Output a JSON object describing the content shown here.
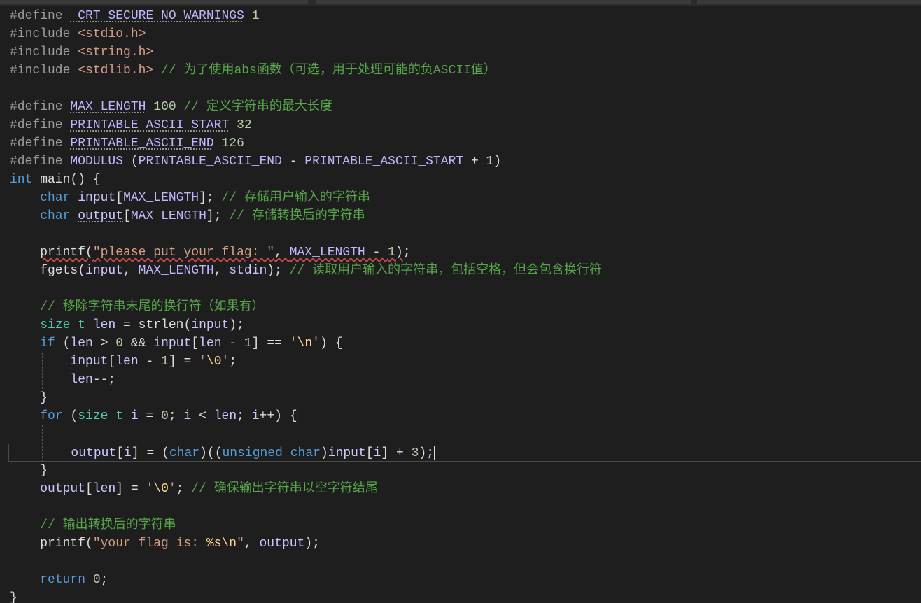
{
  "editor": {
    "theme": {
      "background": "#1e1e1e",
      "text": "#dcdcdc",
      "comment": "#57a64a",
      "keyword": "#569cd6",
      "type": "#4ec9b0",
      "identifier": "#c8c8ff",
      "number": "#b5cea8",
      "string": "#d69d85",
      "macro": "#beb7ff",
      "preprocessor": "#9b9b9b",
      "escape": "#ffd68f"
    },
    "lines": [
      {
        "tokens": [
          {
            "t": "#define ",
            "c": "preprocessor"
          },
          {
            "t": "_CRT_SECURE_NO_WARNINGS",
            "c": "macro",
            "hint": true
          },
          {
            "t": " ",
            "c": "text"
          },
          {
            "t": "1",
            "c": "number"
          }
        ]
      },
      {
        "tokens": [
          {
            "t": "#include ",
            "c": "preprocessor"
          },
          {
            "t": "<stdio.h>",
            "c": "string"
          }
        ]
      },
      {
        "tokens": [
          {
            "t": "#include ",
            "c": "preprocessor"
          },
          {
            "t": "<string.h>",
            "c": "string"
          }
        ]
      },
      {
        "tokens": [
          {
            "t": "#include ",
            "c": "preprocessor"
          },
          {
            "t": "<stdlib.h>",
            "c": "string"
          },
          {
            "t": " // 为了使用abs函数（可选，用于处理可能的负ASCII值）",
            "c": "comment"
          }
        ]
      },
      {
        "tokens": []
      },
      {
        "tokens": [
          {
            "t": "#define ",
            "c": "preprocessor"
          },
          {
            "t": "MAX_LENGTH",
            "c": "macro",
            "hint": true
          },
          {
            "t": " ",
            "c": "text"
          },
          {
            "t": "100",
            "c": "number"
          },
          {
            "t": " // 定义字符串的最大长度",
            "c": "comment"
          }
        ]
      },
      {
        "tokens": [
          {
            "t": "#define ",
            "c": "preprocessor"
          },
          {
            "t": "PRINTABLE_ASCII_START",
            "c": "macro",
            "hint": true
          },
          {
            "t": " ",
            "c": "text"
          },
          {
            "t": "32",
            "c": "number"
          }
        ]
      },
      {
        "tokens": [
          {
            "t": "#define ",
            "c": "preprocessor"
          },
          {
            "t": "PRINTABLE_ASCII_END",
            "c": "macro",
            "hint": true
          },
          {
            "t": " ",
            "c": "text"
          },
          {
            "t": "126",
            "c": "number"
          }
        ]
      },
      {
        "tokens": [
          {
            "t": "#define ",
            "c": "preprocessor"
          },
          {
            "t": "MODULUS",
            "c": "macro"
          },
          {
            "t": " (",
            "c": "text"
          },
          {
            "t": "PRINTABLE_ASCII_END",
            "c": "macro"
          },
          {
            "t": " - ",
            "c": "text"
          },
          {
            "t": "PRINTABLE_ASCII_START",
            "c": "macro"
          },
          {
            "t": " + ",
            "c": "text"
          },
          {
            "t": "1",
            "c": "number"
          },
          {
            "t": ")",
            "c": "text"
          }
        ]
      },
      {
        "tokens": [
          {
            "t": "int",
            "c": "keyword"
          },
          {
            "t": " main() {",
            "c": "text"
          }
        ]
      },
      {
        "tokens": [
          {
            "t": "    ",
            "c": "text"
          },
          {
            "t": "char",
            "c": "keyword"
          },
          {
            "t": " ",
            "c": "text"
          },
          {
            "t": "input",
            "c": "identifier"
          },
          {
            "t": "[",
            "c": "text"
          },
          {
            "t": "MAX_LENGTH",
            "c": "macro"
          },
          {
            "t": "]; ",
            "c": "text"
          },
          {
            "t": "// 存储用户输入的字符串",
            "c": "comment"
          }
        ]
      },
      {
        "tokens": [
          {
            "t": "    ",
            "c": "text"
          },
          {
            "t": "char",
            "c": "keyword"
          },
          {
            "t": " ",
            "c": "text"
          },
          {
            "t": "output",
            "c": "identifier",
            "hint": true
          },
          {
            "t": "[",
            "c": "text"
          },
          {
            "t": "MAX_LENGTH",
            "c": "macro"
          },
          {
            "t": "]; ",
            "c": "text"
          },
          {
            "t": "// 存储转换后的字符串",
            "c": "comment"
          }
        ]
      },
      {
        "tokens": []
      },
      {
        "tokens": [
          {
            "t": "    ",
            "c": "text"
          },
          {
            "t": "printf(",
            "c": "text",
            "err": true
          },
          {
            "t": "\"please put your flag: \"",
            "c": "string",
            "err": true
          },
          {
            "t": ", ",
            "c": "text",
            "err": true
          },
          {
            "t": "MAX_LENGTH",
            "c": "macro",
            "err": true
          },
          {
            "t": " - ",
            "c": "text",
            "err": true
          },
          {
            "t": "1",
            "c": "number",
            "err": true
          },
          {
            "t": ")",
            "c": "text",
            "err": true
          },
          {
            "t": ";",
            "c": "text"
          }
        ]
      },
      {
        "tokens": [
          {
            "t": "    fgets(",
            "c": "text"
          },
          {
            "t": "input",
            "c": "identifier"
          },
          {
            "t": ", ",
            "c": "text"
          },
          {
            "t": "MAX_LENGTH",
            "c": "macro"
          },
          {
            "t": ", ",
            "c": "text"
          },
          {
            "t": "stdin",
            "c": "identifier"
          },
          {
            "t": "); ",
            "c": "text"
          },
          {
            "t": "// 读取用户输入的字符串，包括空格，但会包含换行符",
            "c": "comment"
          }
        ]
      },
      {
        "tokens": []
      },
      {
        "tokens": [
          {
            "t": "    ",
            "c": "text"
          },
          {
            "t": "// 移除字符串末尾的换行符（如果有）",
            "c": "comment"
          }
        ]
      },
      {
        "tokens": [
          {
            "t": "    ",
            "c": "text"
          },
          {
            "t": "size_t",
            "c": "type"
          },
          {
            "t": " ",
            "c": "text"
          },
          {
            "t": "len",
            "c": "identifier"
          },
          {
            "t": " = strlen(",
            "c": "text"
          },
          {
            "t": "input",
            "c": "identifier"
          },
          {
            "t": ");",
            "c": "text"
          }
        ]
      },
      {
        "tokens": [
          {
            "t": "    ",
            "c": "text"
          },
          {
            "t": "if",
            "c": "keyword"
          },
          {
            "t": " (",
            "c": "text"
          },
          {
            "t": "len",
            "c": "identifier"
          },
          {
            "t": " > ",
            "c": "text"
          },
          {
            "t": "0",
            "c": "number"
          },
          {
            "t": " && ",
            "c": "text"
          },
          {
            "t": "input",
            "c": "identifier"
          },
          {
            "t": "[",
            "c": "text"
          },
          {
            "t": "len",
            "c": "identifier"
          },
          {
            "t": " - ",
            "c": "text"
          },
          {
            "t": "1",
            "c": "number"
          },
          {
            "t": "] == ",
            "c": "text"
          },
          {
            "t": "'",
            "c": "string"
          },
          {
            "t": "\\n",
            "c": "escape"
          },
          {
            "t": "'",
            "c": "string"
          },
          {
            "t": ") {",
            "c": "text"
          }
        ]
      },
      {
        "tokens": [
          {
            "t": "        ",
            "c": "text"
          },
          {
            "t": "input",
            "c": "identifier"
          },
          {
            "t": "[",
            "c": "text"
          },
          {
            "t": "len",
            "c": "identifier"
          },
          {
            "t": " - ",
            "c": "text"
          },
          {
            "t": "1",
            "c": "number"
          },
          {
            "t": "] = ",
            "c": "text"
          },
          {
            "t": "'",
            "c": "string"
          },
          {
            "t": "\\0",
            "c": "escape"
          },
          {
            "t": "'",
            "c": "string"
          },
          {
            "t": ";",
            "c": "text"
          }
        ]
      },
      {
        "tokens": [
          {
            "t": "        ",
            "c": "text"
          },
          {
            "t": "len",
            "c": "identifier"
          },
          {
            "t": "--;",
            "c": "text"
          }
        ]
      },
      {
        "tokens": [
          {
            "t": "    }",
            "c": "text"
          }
        ]
      },
      {
        "tokens": [
          {
            "t": "    ",
            "c": "text"
          },
          {
            "t": "for",
            "c": "keyword"
          },
          {
            "t": " (",
            "c": "text"
          },
          {
            "t": "size_t",
            "c": "type"
          },
          {
            "t": " ",
            "c": "text"
          },
          {
            "t": "i",
            "c": "identifier"
          },
          {
            "t": " = ",
            "c": "text"
          },
          {
            "t": "0",
            "c": "number"
          },
          {
            "t": "; ",
            "c": "text"
          },
          {
            "t": "i",
            "c": "identifier"
          },
          {
            "t": " < ",
            "c": "text"
          },
          {
            "t": "len",
            "c": "identifier"
          },
          {
            "t": "; ",
            "c": "text"
          },
          {
            "t": "i",
            "c": "identifier"
          },
          {
            "t": "++) {",
            "c": "text"
          }
        ]
      },
      {
        "tokens": []
      },
      {
        "current": true,
        "tokens": [
          {
            "t": "        ",
            "c": "text"
          },
          {
            "t": "output",
            "c": "identifier"
          },
          {
            "t": "[",
            "c": "text"
          },
          {
            "t": "i",
            "c": "identifier"
          },
          {
            "t": "] = (",
            "c": "text"
          },
          {
            "t": "char",
            "c": "keyword"
          },
          {
            "t": ")((",
            "c": "text"
          },
          {
            "t": "unsigned",
            "c": "keyword"
          },
          {
            "t": " ",
            "c": "text"
          },
          {
            "t": "char",
            "c": "keyword"
          },
          {
            "t": ")",
            "c": "text"
          },
          {
            "t": "input",
            "c": "identifier"
          },
          {
            "t": "[",
            "c": "text"
          },
          {
            "t": "i",
            "c": "identifier"
          },
          {
            "t": "] + ",
            "c": "text"
          },
          {
            "t": "3",
            "c": "number"
          },
          {
            "t": ");",
            "c": "text"
          }
        ]
      },
      {
        "tokens": [
          {
            "t": "    }",
            "c": "text"
          }
        ]
      },
      {
        "tokens": [
          {
            "t": "    ",
            "c": "text"
          },
          {
            "t": "output",
            "c": "identifier"
          },
          {
            "t": "[",
            "c": "text"
          },
          {
            "t": "len",
            "c": "identifier"
          },
          {
            "t": "] = ",
            "c": "text"
          },
          {
            "t": "'",
            "c": "string"
          },
          {
            "t": "\\0",
            "c": "escape"
          },
          {
            "t": "'",
            "c": "string"
          },
          {
            "t": "; ",
            "c": "text"
          },
          {
            "t": "// 确保输出字符串以空字符结尾",
            "c": "comment"
          }
        ]
      },
      {
        "tokens": []
      },
      {
        "tokens": [
          {
            "t": "    ",
            "c": "text"
          },
          {
            "t": "// 输出转换后的字符串",
            "c": "comment"
          }
        ]
      },
      {
        "tokens": [
          {
            "t": "    printf(",
            "c": "text"
          },
          {
            "t": "\"your flag is: ",
            "c": "string"
          },
          {
            "t": "%s",
            "c": "escape"
          },
          {
            "t": "\\n",
            "c": "escape"
          },
          {
            "t": "\"",
            "c": "string"
          },
          {
            "t": ", ",
            "c": "text"
          },
          {
            "t": "output",
            "c": "identifier"
          },
          {
            "t": ");",
            "c": "text"
          }
        ]
      },
      {
        "tokens": []
      },
      {
        "tokens": [
          {
            "t": "    ",
            "c": "text"
          },
          {
            "t": "return",
            "c": "keyword"
          },
          {
            "t": " ",
            "c": "text"
          },
          {
            "t": "0",
            "c": "number"
          },
          {
            "t": ";",
            "c": "text"
          }
        ]
      },
      {
        "tokens": [
          {
            "t": "}",
            "c": "text"
          }
        ]
      }
    ]
  }
}
